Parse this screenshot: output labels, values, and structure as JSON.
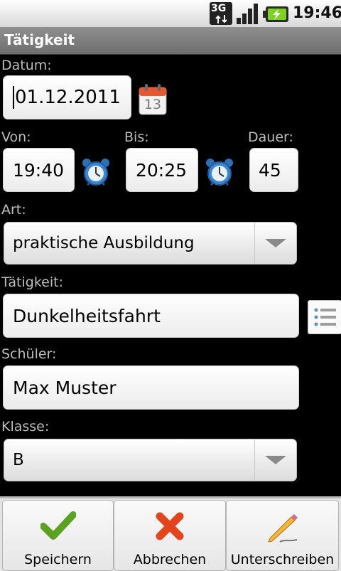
{
  "status_bar": {
    "network": "3G",
    "time": "19:46",
    "icons": [
      "3g-icon",
      "signal-icon",
      "battery-charging-icon"
    ]
  },
  "title_bar": {
    "title": "Tätigkeit"
  },
  "form": {
    "datum_label": "Datum:",
    "datum_value": "01.12.2011",
    "calendar_day": "13",
    "von_label": "Von:",
    "von_value": "19:40",
    "bis_label": "Bis:",
    "bis_value": "20:25",
    "dauer_label": "Dauer:",
    "dauer_value": "45",
    "art_label": "Art:",
    "art_value": "praktische Ausbildung",
    "taetigkeit_label": "Tätigkeit:",
    "taetigkeit_value": "Dunkelheitsfahrt",
    "schueler_label": "Schüler:",
    "schueler_value": "Max Muster",
    "klasse_label": "Klasse:",
    "klasse_value": "B"
  },
  "actions": {
    "save_label": "Speichern",
    "cancel_label": "Abbrechen",
    "sign_label": "Unterschreiben"
  },
  "colors": {
    "background": "#000000",
    "titlebar": "#7d7d7d",
    "label": "#bdbdbd",
    "check_green": "#5aa21f",
    "cancel_red": "#e2451c",
    "calendar_red": "#e8572f"
  }
}
